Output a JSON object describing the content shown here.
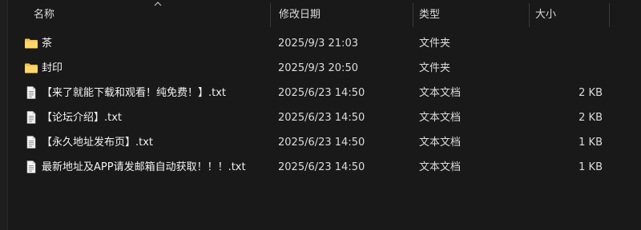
{
  "columns": {
    "name": "名称",
    "date": "修改日期",
    "type": "类型",
    "size": "大小"
  },
  "sort": {
    "column": "name",
    "icon": "chevron-up-icon"
  },
  "files": [
    {
      "icon": "folder-icon",
      "name": "茶",
      "date": "2025/9/3 21:03",
      "type": "文件夹",
      "size": ""
    },
    {
      "icon": "folder-icon",
      "name": "封印",
      "date": "2025/9/3 20:50",
      "type": "文件夹",
      "size": ""
    },
    {
      "icon": "text-file-icon",
      "name": "【来了就能下载和观看！纯免费！】.txt",
      "date": "2025/6/23 14:50",
      "type": "文本文档",
      "size": "2 KB"
    },
    {
      "icon": "text-file-icon",
      "name": "【论坛介绍】.txt",
      "date": "2025/6/23 14:50",
      "type": "文本文档",
      "size": "2 KB"
    },
    {
      "icon": "text-file-icon",
      "name": "【永久地址发布页】.txt",
      "date": "2025/6/23 14:50",
      "type": "文本文档",
      "size": "1 KB"
    },
    {
      "icon": "text-file-icon",
      "name": "最新地址及APP请发邮箱自动获取！！！.txt",
      "date": "2025/6/23 14:50",
      "type": "文本文档",
      "size": "1 KB"
    }
  ],
  "colors": {
    "background": "#191919",
    "folder": "#f5c34a",
    "text": "#f2f2f2"
  }
}
